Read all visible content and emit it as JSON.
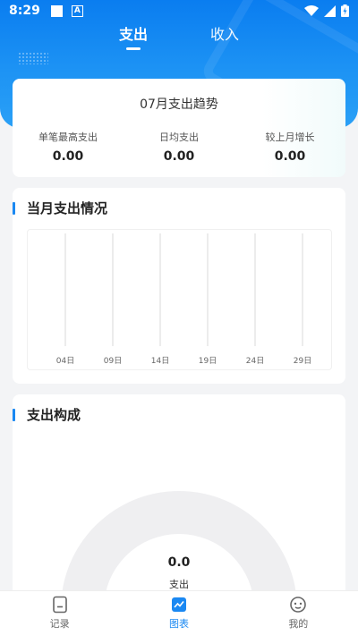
{
  "status_bar": {
    "time": "8:29",
    "notification_letter": "A"
  },
  "tabs": [
    {
      "label": "支出",
      "active": true
    },
    {
      "label": "收入",
      "active": false
    }
  ],
  "summary": {
    "title": "07月支出趋势",
    "metrics": [
      {
        "label": "单笔最高支出",
        "value": "0.00"
      },
      {
        "label": "日均支出",
        "value": "0.00"
      },
      {
        "label": "较上月增长",
        "value": "0.00"
      }
    ]
  },
  "monthly": {
    "title": "当月支出情况",
    "chart_data": {
      "type": "bar",
      "categories": [
        "04日",
        "09日",
        "14日",
        "19日",
        "24日",
        "29日"
      ],
      "values": [
        0,
        0,
        0,
        0,
        0,
        0
      ],
      "title": "",
      "xlabel": "",
      "ylabel": "",
      "grid": true
    }
  },
  "composition": {
    "title": "支出构成",
    "total": "0.0",
    "total_label": "支出"
  },
  "bottom_nav": [
    {
      "label": "记录",
      "icon": "record-icon",
      "active": false
    },
    {
      "label": "图表",
      "icon": "chart-icon",
      "active": true
    },
    {
      "label": "我的",
      "icon": "profile-icon",
      "active": false
    }
  ],
  "colors": {
    "accent": "#1a88f2",
    "header": "#0a7df0",
    "background": "#f3f4f6"
  }
}
